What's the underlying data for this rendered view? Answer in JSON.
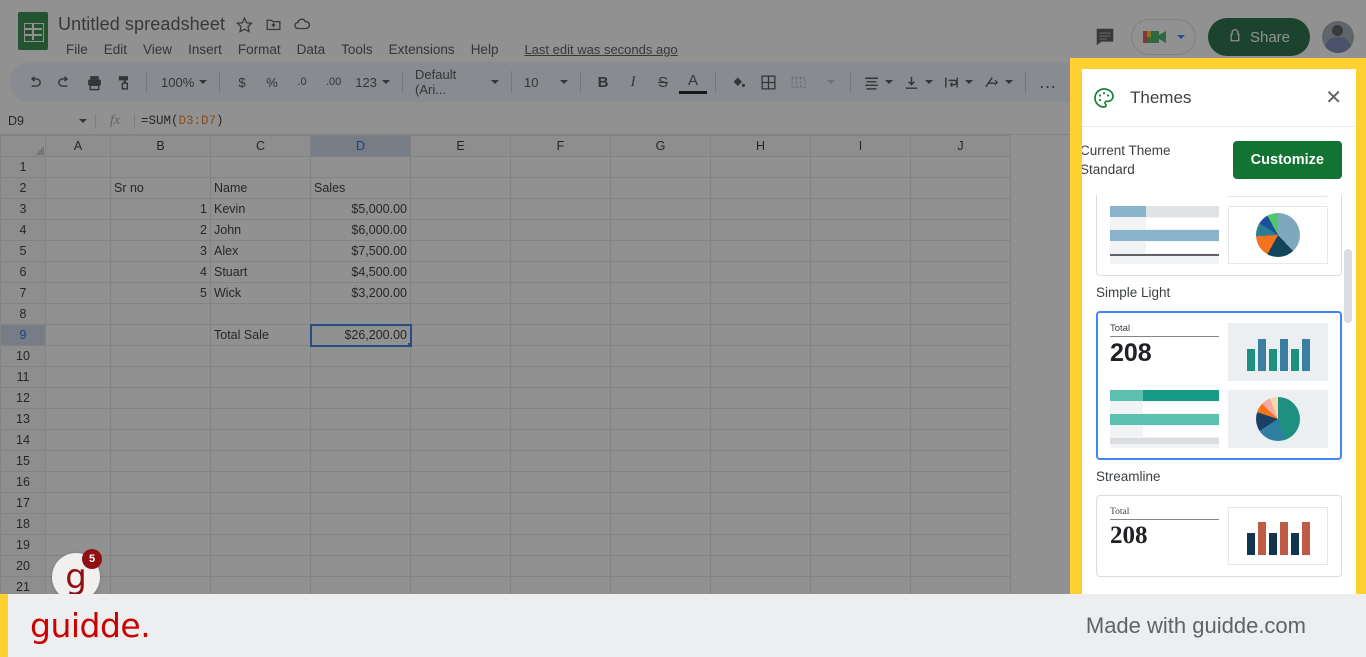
{
  "app": {
    "doc_title": "Untitled spreadsheet",
    "last_edit": "Last edit was seconds ago",
    "logo_icon": "sheets-logo-icon",
    "star_icon": "star-icon",
    "move_icon": "move-to-folder-icon",
    "cloud_icon": "cloud-status-icon"
  },
  "menus": [
    {
      "label": "File"
    },
    {
      "label": "Edit"
    },
    {
      "label": "View"
    },
    {
      "label": "Insert"
    },
    {
      "label": "Format"
    },
    {
      "label": "Data"
    },
    {
      "label": "Tools"
    },
    {
      "label": "Extensions"
    },
    {
      "label": "Help"
    }
  ],
  "header_right": {
    "comment_icon": "comment-icon",
    "meet_icon": "google-meet-icon",
    "share_label": "Share",
    "lock_icon": "lock-icon",
    "avatar": "user-avatar"
  },
  "toolbar": {
    "undo": "↶",
    "redo": "↷",
    "print": "print-icon",
    "paint": "paint-format-icon",
    "zoom": "100%",
    "currency": "$",
    "percent": "%",
    "dec_decimal": ".0",
    "inc_decimal": ".00",
    "formats": "123",
    "font": "Default (Ari...",
    "font_size": "10",
    "bold": "B",
    "italic": "I",
    "strikethrough": "S",
    "text_color": "A",
    "fill_color": "fill-color-icon",
    "borders": "borders-icon",
    "merge": "merge-cells-icon",
    "halign": "horizontal-align-icon",
    "valign": "vertical-align-icon",
    "wrap": "text-wrap-icon",
    "rotate": "text-rotation-icon",
    "more": "…",
    "collapse": "⌃"
  },
  "formula_bar": {
    "name_box": "D9",
    "fx": "fx",
    "formula_prefix": "=SUM(",
    "formula_ref": "D3:D7",
    "formula_suffix": ")"
  },
  "grid": {
    "columns": [
      "A",
      "B",
      "C",
      "D",
      "E",
      "F",
      "G",
      "H",
      "I",
      "J"
    ],
    "selected_column": "D",
    "selected_row": 9,
    "rows": [
      {
        "n": 1,
        "B": "",
        "C": "",
        "D": ""
      },
      {
        "n": 2,
        "B": "Sr no",
        "C": "Name",
        "D": "Sales"
      },
      {
        "n": 3,
        "B": "1",
        "C": "Kevin",
        "D": "$5,000.00"
      },
      {
        "n": 4,
        "B": "2",
        "C": "John",
        "D": "$6,000.00"
      },
      {
        "n": 5,
        "B": "3",
        "C": "Alex",
        "D": "$7,500.00"
      },
      {
        "n": 6,
        "B": "4",
        "C": "Stuart",
        "D": "$4,500.00"
      },
      {
        "n": 7,
        "B": "5",
        "C": "Wick",
        "D": "$3,200.00"
      },
      {
        "n": 8,
        "B": "",
        "C": "",
        "D": ""
      },
      {
        "n": 9,
        "B": "",
        "C": "Total Sale",
        "D": "$26,200.00"
      },
      {
        "n": 10,
        "B": "",
        "C": "",
        "D": ""
      },
      {
        "n": 11,
        "B": "",
        "C": "",
        "D": ""
      },
      {
        "n": 12,
        "B": "",
        "C": "",
        "D": ""
      },
      {
        "n": 13,
        "B": "",
        "C": "",
        "D": ""
      },
      {
        "n": 14,
        "B": "",
        "C": "",
        "D": ""
      },
      {
        "n": 15,
        "B": "",
        "C": "",
        "D": ""
      },
      {
        "n": 16,
        "B": "",
        "C": "",
        "D": ""
      },
      {
        "n": 17,
        "B": "",
        "C": "",
        "D": ""
      },
      {
        "n": 18,
        "B": "",
        "C": "",
        "D": ""
      },
      {
        "n": 19,
        "B": "",
        "C": "",
        "D": ""
      },
      {
        "n": 20,
        "B": "",
        "C": "",
        "D": ""
      },
      {
        "n": 21,
        "B": "",
        "C": "",
        "D": ""
      }
    ]
  },
  "themes_panel": {
    "title": "Themes",
    "palette_icon": "palette-icon",
    "close_icon": "close-icon",
    "current_theme_line1": "Current Theme",
    "current_theme_line2": "Standard",
    "customize_label": "Customize",
    "highlight_color": "#ffd02f",
    "accent_color": "#137333",
    "cards": [
      {
        "id": "partial-top",
        "name": "",
        "kpi_label": "",
        "kpi_value": "",
        "selected": false,
        "bar_colors": [
          "#7fb0c9",
          "#2d7290",
          "#7fb0c9",
          "#2d7290"
        ],
        "table_colors": [
          "#8ab4cb",
          "#dfe3e6",
          "#8ab4cb",
          "#dfe3e6"
        ],
        "pie_colors": [
          "#7fa8bd",
          "#124559",
          "#f4731c",
          "#2e7d8f",
          "#1a4fa0",
          "#4cc76a"
        ],
        "pie_stops": [
          0,
          38,
          58,
          74,
          84,
          92,
          100
        ]
      },
      {
        "id": "simple-light",
        "name": "Simple Light",
        "kpi_label": "Total",
        "kpi_value": "208",
        "selected": true,
        "bar_colors": [
          "#1e9080",
          "#3b7ea1",
          "#1e9080",
          "#3b7ea1",
          "#1e9080",
          "#3b7ea1"
        ],
        "table_colors": [
          "#5cc0ae",
          "#189b86",
          "#f1f3f4",
          "#5cc0ae",
          "#f1f3f4"
        ],
        "pie_colors": [
          "#1e9080",
          "#2f7fa0",
          "#1c3f66",
          "#f4731c",
          "#f7a9a0",
          "#f6d9ae"
        ],
        "pie_stops": [
          0,
          45,
          66,
          80,
          87,
          94,
          100
        ]
      },
      {
        "id": "streamline",
        "name": "Streamline",
        "kpi_label": "Total",
        "kpi_value": "208",
        "selected": false,
        "bar_colors": [
          "#12354f",
          "#bf5b45",
          "#12354f",
          "#bf5b45",
          "#12354f",
          "#bf5b45"
        ],
        "table_colors": [],
        "pie_colors": [],
        "pie_stops": []
      }
    ]
  },
  "guidde": {
    "widget_letter": "g",
    "widget_badge": "5",
    "footer_logo": "guidde.",
    "footer_made": "Made with guidde.com"
  }
}
